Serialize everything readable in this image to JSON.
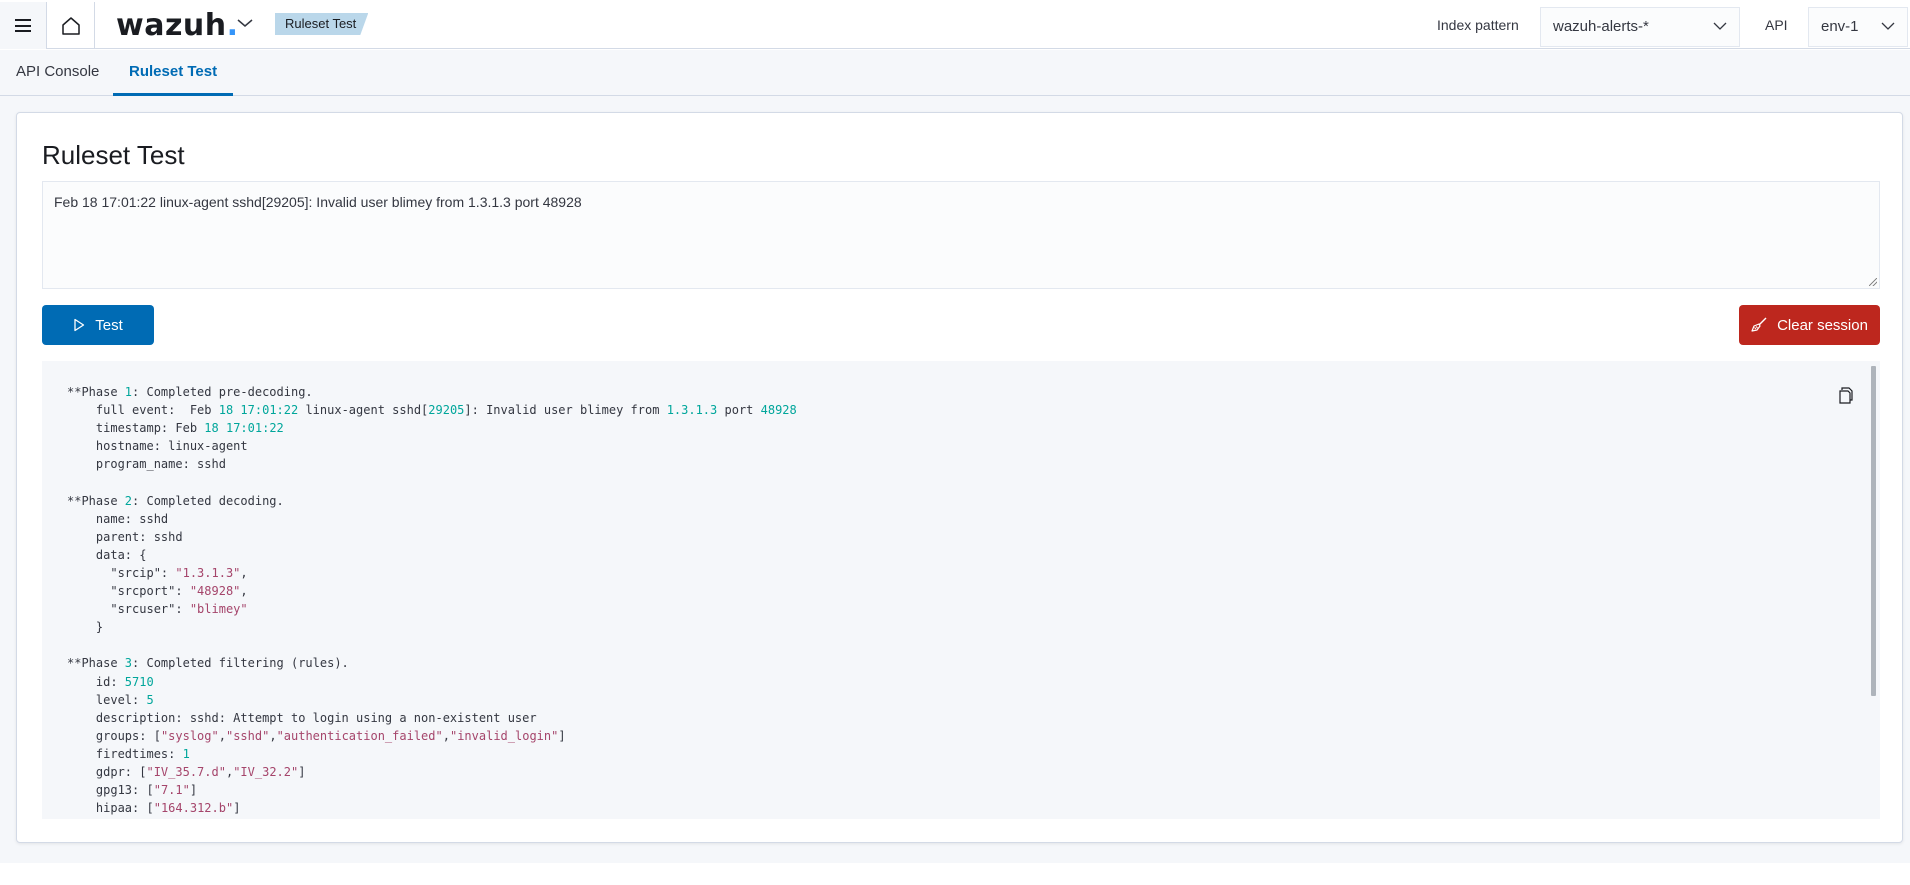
{
  "header": {
    "logo_text": "wazuh",
    "logo_dot": ".",
    "breadcrumb": "Ruleset Test",
    "index_pattern_label": "Index pattern",
    "index_pattern_value": "wazuh-alerts-*",
    "api_label": "API",
    "api_value": "env-1",
    "icons": [
      "menu-icon",
      "home-icon",
      "chevron-down-icon"
    ]
  },
  "tabs": [
    {
      "label": "API Console",
      "active": false
    },
    {
      "label": "Ruleset Test",
      "active": true
    }
  ],
  "panel": {
    "title": "Ruleset Test",
    "event_input_value": "Feb 18 17:01:22 linux-agent sshd[29205]: Invalid user blimey from 1.3.1.3 port 48928",
    "test_button": "Test",
    "clear_button": "Clear session"
  },
  "output": {
    "phase1": {
      "header": "**Phase 1: Completed pre-decoding.",
      "full_event": "Feb 18 17:01:22 linux-agent sshd[29205]: Invalid user blimey from 1.3.1.3 port 48928",
      "timestamp": "Feb 18 17:01:22",
      "hostname": "linux-agent",
      "program_name": "sshd"
    },
    "phase2": {
      "header": "**Phase 2: Completed decoding.",
      "name": "sshd",
      "parent": "sshd",
      "data": {
        "srcip": "1.3.1.3",
        "srcport": "48928",
        "srcuser": "blimey"
      }
    },
    "phase3": {
      "header": "**Phase 3: Completed filtering (rules).",
      "id": "5710",
      "level": "5",
      "description": "sshd: Attempt to login using a non-existent user",
      "groups": [
        "syslog",
        "sshd",
        "authentication_failed",
        "invalid_login"
      ],
      "firedtimes": "1",
      "gdpr": [
        "IV_35.7.d",
        "IV_32.2"
      ],
      "gpg13": [
        "7.1"
      ],
      "hipaa": [
        "164.312.b"
      ]
    }
  },
  "colors": {
    "primary": "#006bb4",
    "danger": "#bd271e",
    "breadcrumb_bg": "#bad7ea",
    "code_bg": "#f5f7fa",
    "string": "#a5456b",
    "number": "#00a69b"
  }
}
